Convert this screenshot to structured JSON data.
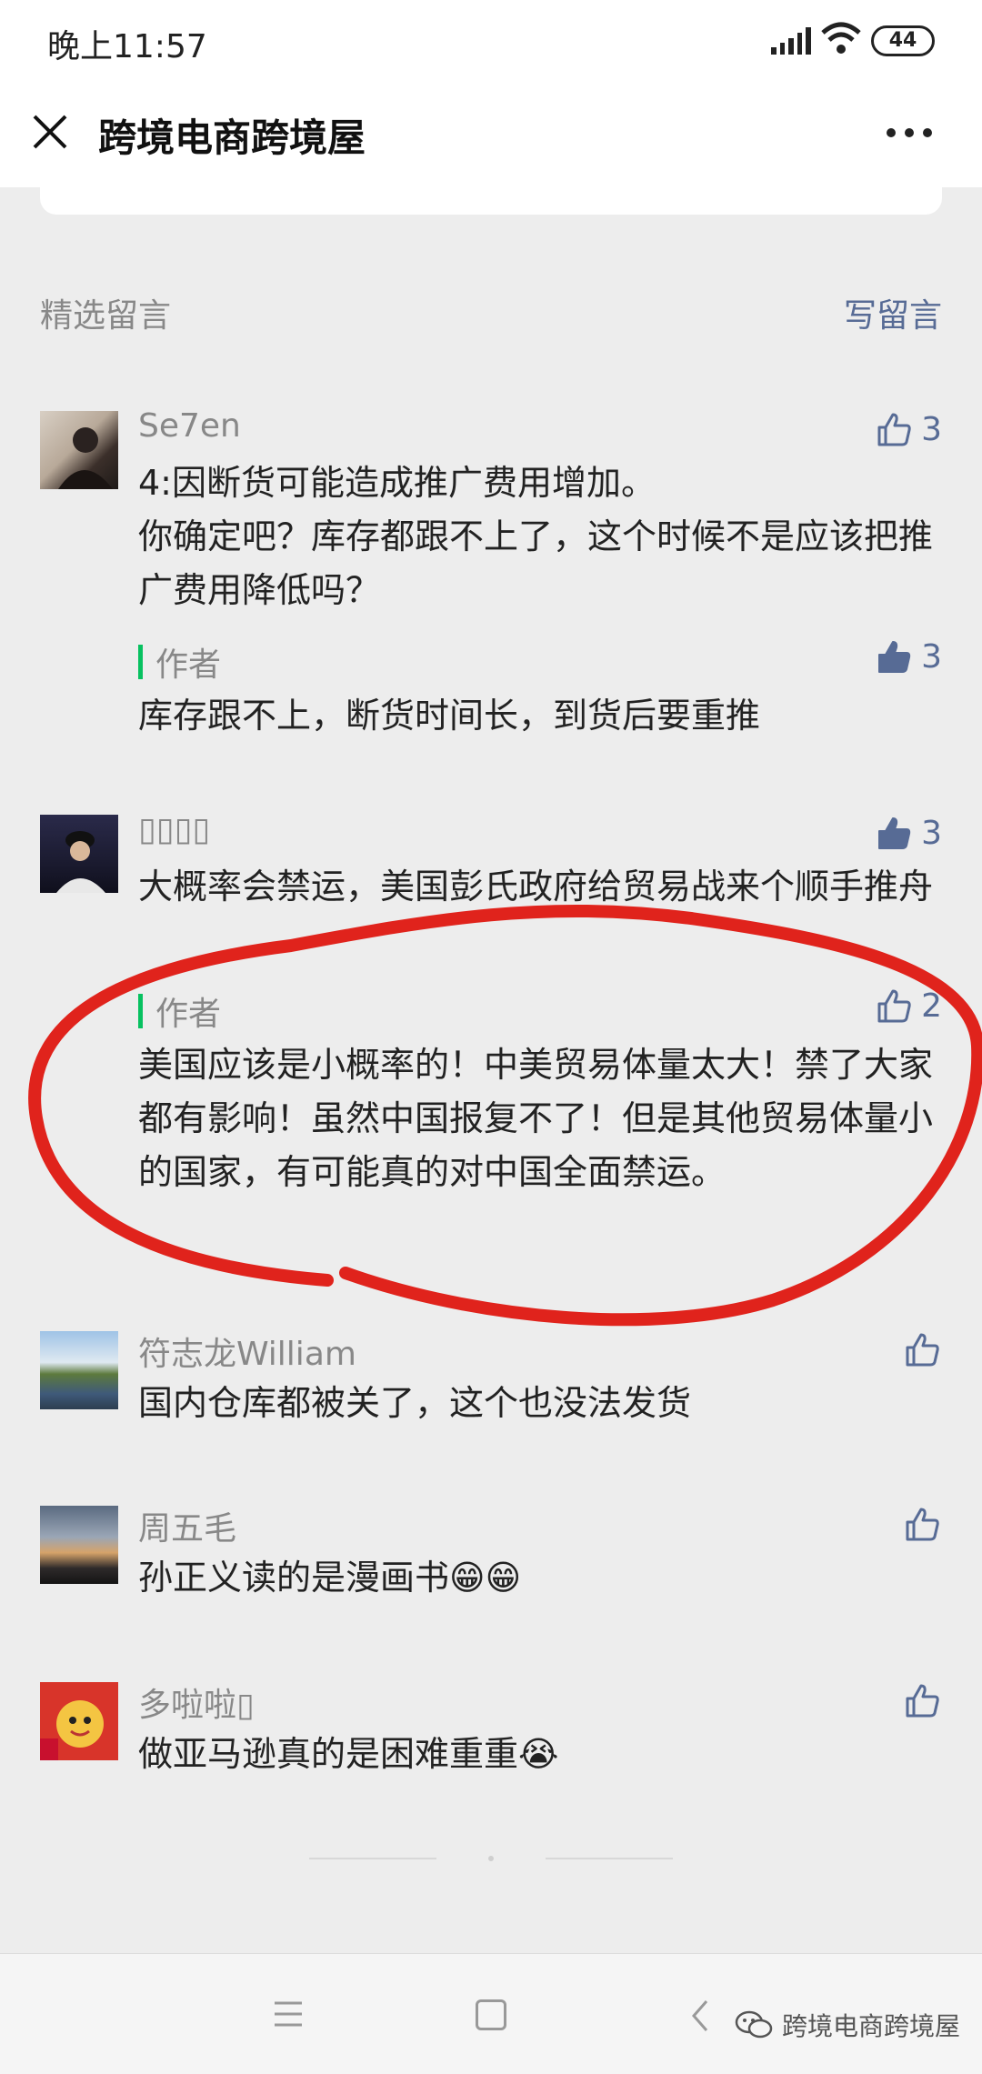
{
  "status": {
    "time": "晚上11:57",
    "battery": "44"
  },
  "header": {
    "title": "跨境电商跨境屋"
  },
  "section": {
    "title": "精选留言",
    "write": "写留言"
  },
  "comments": [
    {
      "nick": "Se7en",
      "likes": "3",
      "text": "4:因断货可能造成推广费用增加。\n你确定吧？库存都跟不上了，这个时候不是应该把推广费用降低吗？",
      "reply": {
        "label": "作者",
        "likes": "3",
        "text": "库存跟不上，断货时间长，到货后要重推"
      }
    },
    {
      "nick": "▯▯▯▯",
      "likes": "3",
      "text": "大概率会禁运，美国彭氏政府给贸易战来个顺手推舟",
      "reply": {
        "label": "作者",
        "likes": "2",
        "text": "美国应该是小概率的！中美贸易体量太大！禁了大家都有影响！虽然中国报复不了！但是其他贸易体量小的国家，有可能真的对中国全面禁运。"
      }
    },
    {
      "nick": "符志龙William",
      "likes": "",
      "text": "国内仓库都被关了，这个也没法发货"
    },
    {
      "nick": "周五毛",
      "likes": "",
      "text": "孙正义读的是漫画书😁😁"
    },
    {
      "nick": "多啦啦▯",
      "likes": "",
      "text": "做亚马逊真的是困难重重😭"
    }
  ],
  "watermark": "跨境电商跨境屋",
  "colors": {
    "link": "#576b95",
    "accent_bar": "#07c160",
    "scribble": "#e0231c"
  }
}
